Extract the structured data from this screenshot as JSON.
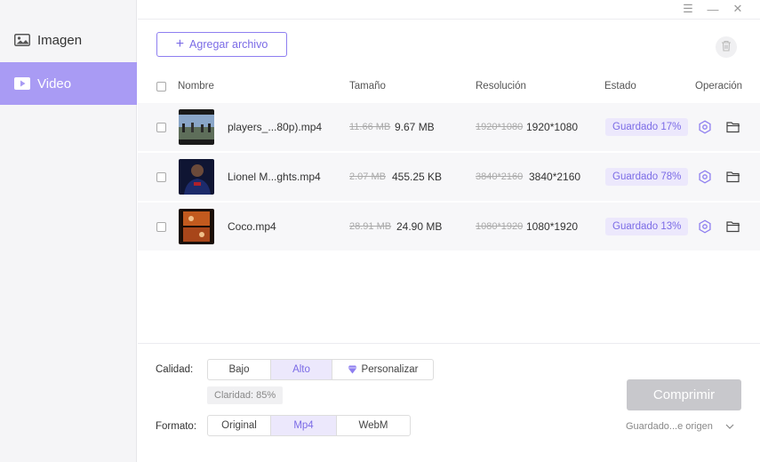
{
  "sidebar": {
    "items": [
      {
        "label": "Imagen",
        "icon": "image-icon",
        "active": false
      },
      {
        "label": "Video",
        "icon": "video-icon",
        "active": true
      }
    ]
  },
  "window_controls": {
    "menu": "☰",
    "minimize": "—",
    "close": "✕"
  },
  "toolbar": {
    "add_label": "Agregar archivo"
  },
  "table": {
    "headers": {
      "name": "Nombre",
      "size": "Tamaño",
      "resolution": "Resolución",
      "status": "Estado",
      "operation": "Operación"
    },
    "rows": [
      {
        "name": "players_...80p).mp4",
        "old_size": "11.66 MB",
        "new_size": "9.67 MB",
        "old_res": "1920*1080",
        "new_res": "1920*1080",
        "status": "Guardado 17%"
      },
      {
        "name": "Lionel M...ghts.mp4",
        "old_size": "2.07 MB",
        "new_size": "455.25 KB",
        "old_res": "3840*2160",
        "new_res": "3840*2160",
        "status": "Guardado 78%"
      },
      {
        "name": "Coco.mp4",
        "old_size": "28.91 MB",
        "new_size": "24.90 MB",
        "old_res": "1080*1920",
        "new_res": "1080*1920",
        "status": "Guardado 13%"
      }
    ]
  },
  "settings": {
    "quality_label": "Calidad:",
    "quality_options": [
      "Bajo",
      "Alto",
      "Personalizar"
    ],
    "quality_selected": "Alto",
    "clarity": "Claridad: 85%",
    "format_label": "Formato:",
    "format_options": [
      "Original",
      "Mp4",
      "WebM"
    ],
    "format_selected": "Mp4"
  },
  "actions": {
    "compress_label": "Comprimir",
    "save_location": "Guardado...e origen"
  },
  "colors": {
    "accent": "#8e7ef0",
    "sidebar_active": "#a99bf4",
    "badge_bg": "#ece8fc"
  }
}
